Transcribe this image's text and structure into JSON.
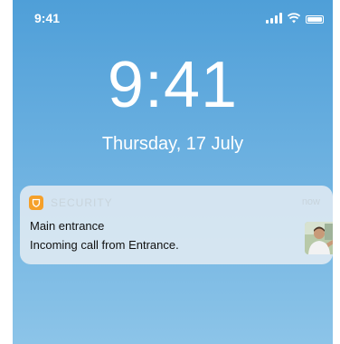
{
  "status_bar": {
    "time": "9:41",
    "icons": [
      "signal-icon",
      "wifi-icon",
      "battery-icon"
    ]
  },
  "lock_screen": {
    "time": "9:41",
    "date": "Thursday, 17 July"
  },
  "notification": {
    "app_name": "SECURITY",
    "app_icon": "shield-icon",
    "app_icon_color": "#f5a02a",
    "timestamp": "now",
    "title": "Main entrance",
    "body": "Incoming call from Entrance.",
    "thumbnail": "visitor-photo"
  },
  "colors": {
    "background_top": "#4f9fd8",
    "background_bottom": "#8cc4e8",
    "notification_bg": "#dce8f2"
  }
}
